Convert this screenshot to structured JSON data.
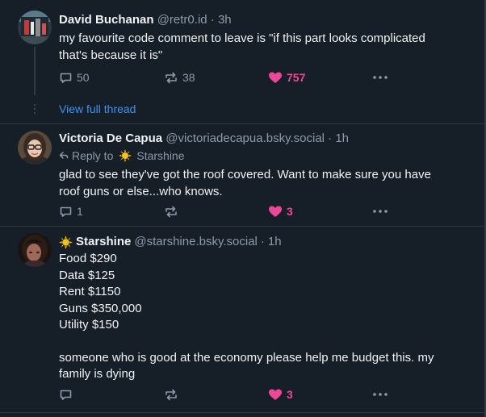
{
  "posts": [
    {
      "display_name": "David Buchanan",
      "handle": "@retr0.id",
      "time": "3h",
      "body": [
        "my favourite code comment to leave is \"if this part looks complicated",
        "that's because it is\""
      ],
      "replies": "50",
      "reposts": "38",
      "likes": "757"
    },
    {
      "display_name": "Victoria De Capua",
      "handle": "@victoriadecapua.bsky.social",
      "time": "1h",
      "reply_prefix": "Reply to",
      "reply_target": "Starshine",
      "body": [
        "glad to see they've got the roof covered. Want to make sure you have",
        "roof guns or else...who knows."
      ],
      "replies": "1",
      "reposts": "",
      "likes": "3"
    },
    {
      "display_name": "Starshine",
      "handle": "@starshine.bsky.social",
      "time": "1h",
      "body": [
        "Food $290",
        "Data $125",
        "Rent $1150",
        "Guns $350,000",
        "Utility $150",
        "",
        "someone who is good at the economy please help me budget this. my",
        "family is dying"
      ],
      "replies": "",
      "reposts": "",
      "likes": "3"
    }
  ],
  "view_full_thread": "View full thread",
  "separator": "·",
  "colors": {
    "background": "#161e27",
    "like": "#ec4899",
    "link": "#3c94f5",
    "muted": "#8c9bab",
    "text": "#f1f3f5"
  },
  "icons": [
    "reply-icon",
    "repost-icon",
    "like-icon",
    "more-icon",
    "sun-emoji-icon"
  ]
}
